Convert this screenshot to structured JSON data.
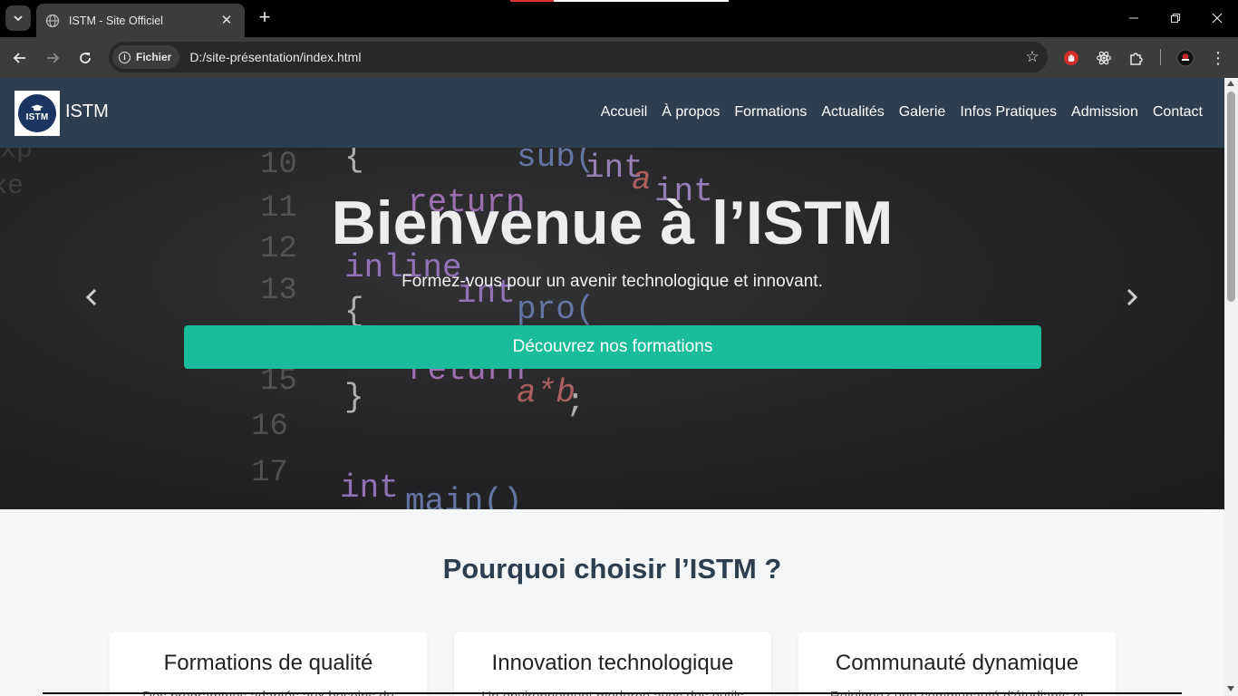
{
  "browser": {
    "tab_title": "ISTM - Site Officiel",
    "chip_label": "Fichier",
    "url": "D:/site-présentation/index.html",
    "icons": [
      "tab-search-icon",
      "globe-icon",
      "close-icon",
      "plus-icon",
      "minimize-icon",
      "restore-icon",
      "close-window-icon",
      "back-icon",
      "forward-icon",
      "reload-icon",
      "info-icon",
      "star-icon",
      "hand-extension-icon",
      "react-extension-icon",
      "puzzle-icon",
      "profile-icon",
      "kebab-menu-icon"
    ]
  },
  "site": {
    "brand": "ISTM",
    "logo_text": "ISTM",
    "nav": [
      "Accueil",
      "À propos",
      "Formations",
      "Actualités",
      "Galerie",
      "Infos Pratiques",
      "Admission",
      "Contact"
    ],
    "hero": {
      "title": "Bienvenue à l’ISTM",
      "subtitle": "Formez-vous pour un avenir technologique et innovant.",
      "cta": "Découvrez nos formations"
    },
    "why": {
      "title": "Pourquoi choisir l’ISTM ?",
      "cards": [
        {
          "title": "Formations de qualité",
          "text": "Des programmes adaptés aux besoins du"
        },
        {
          "title": "Innovation technologique",
          "text": "Un environnement moderne avec des outils"
        },
        {
          "title": "Communauté dynamique",
          "text": "Rejoignez une communauté d’étudiants et"
        }
      ]
    }
  },
  "colors": {
    "header": "#2d3e50",
    "accent": "#1abc9c",
    "title": "#2c3e50",
    "page_bg": "#f4f6f8"
  }
}
